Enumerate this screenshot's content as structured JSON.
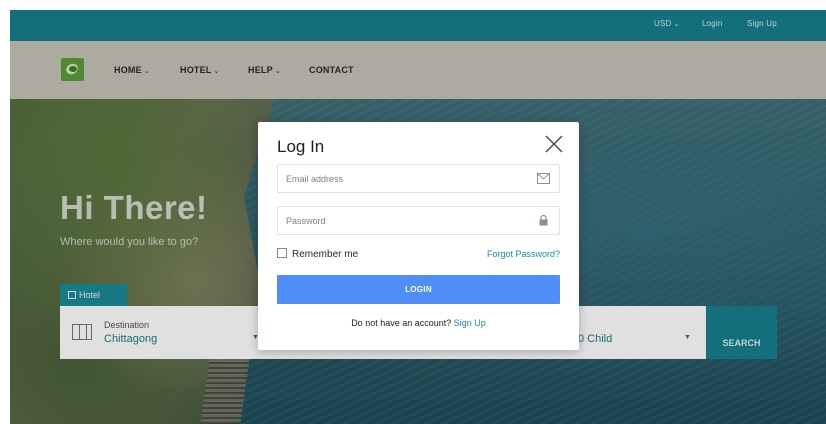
{
  "topbar": {
    "currency": "USD",
    "login": "Login",
    "signup": "Sign Up"
  },
  "nav": {
    "items": [
      {
        "label": "HOME",
        "caret": "⌄"
      },
      {
        "label": "HOTEL",
        "caret": "⌄"
      },
      {
        "label": "HELP",
        "caret": "⌄"
      },
      {
        "label": "CONTACT"
      }
    ]
  },
  "hero": {
    "title": "Hi There!",
    "subtitle": "Where would you like to go?",
    "tab_label": "Hotel"
  },
  "search": {
    "destination_label": "Destination",
    "destination_value": "Chittagong",
    "children_value": "0 Child",
    "button_label": "SEARCH"
  },
  "modal": {
    "title": "Log In",
    "email_placeholder": "Email address",
    "password_placeholder": "Password",
    "remember_label": "Remember me",
    "forgot_label": "Forgot Password?",
    "login_button": "LOGIN",
    "no_account_text": "Do not have an account?",
    "signup_link": "Sign Up"
  },
  "colors": {
    "teal": "#157f8c",
    "login_blue": "#4f8ef7",
    "link_teal": "#1c8aa0"
  }
}
